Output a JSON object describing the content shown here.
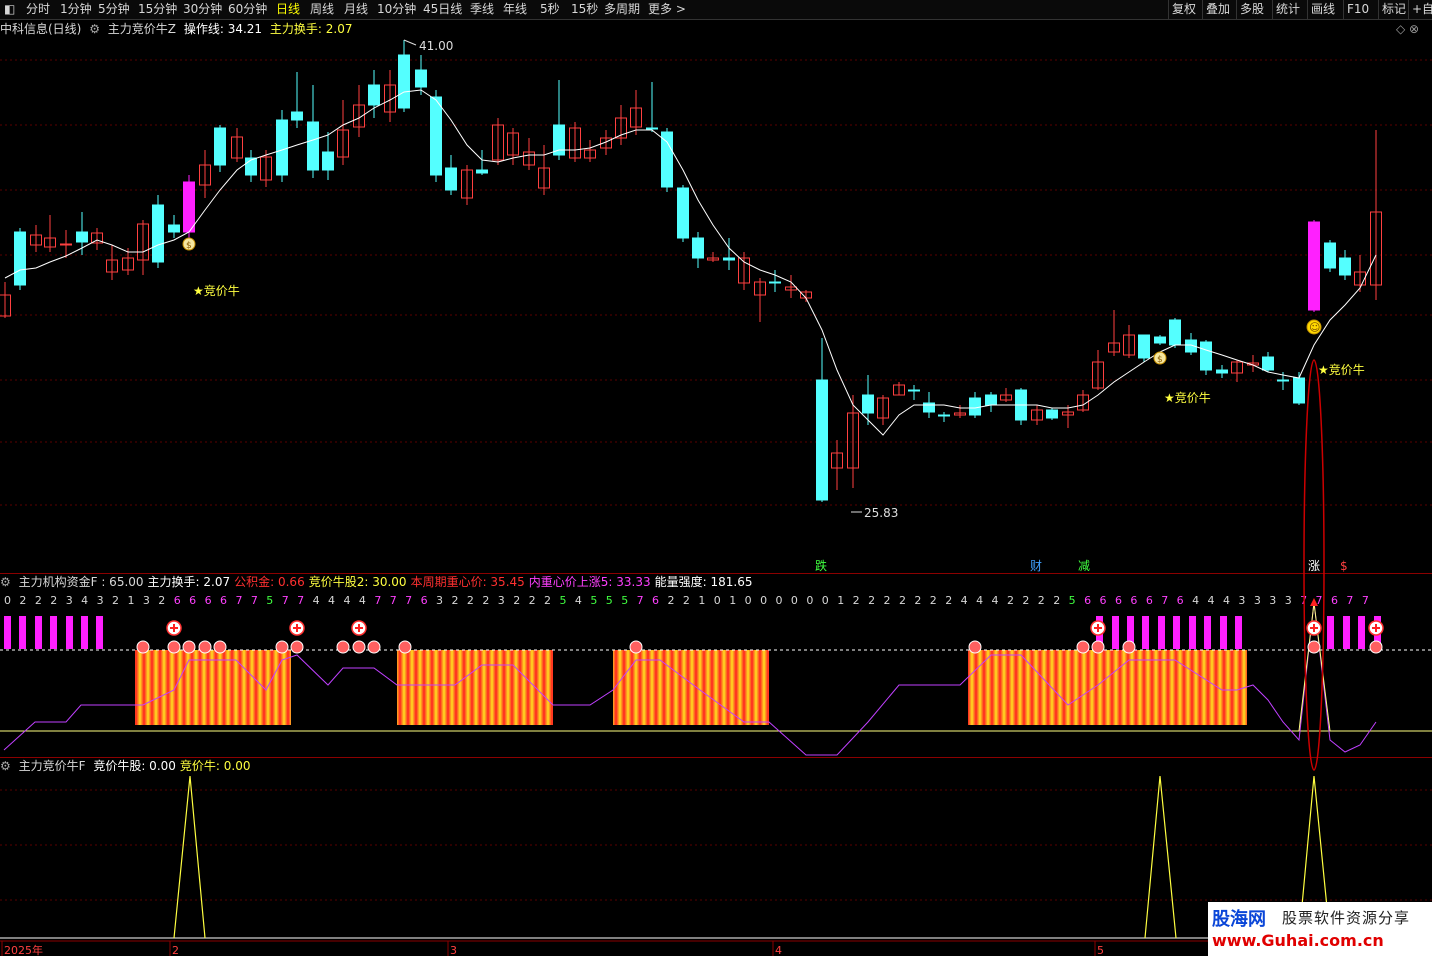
{
  "toolbar": {
    "left_icon": "window-icon",
    "periods": [
      "分时",
      "1分钟",
      "5分钟",
      "15分钟",
      "30分钟",
      "60分钟",
      "日线",
      "周线",
      "月线",
      "10分钟",
      "45日线",
      "季线",
      "年线",
      "5秒",
      "15秒",
      "多周期",
      "更多 >"
    ],
    "active_index": 6,
    "right_tools": [
      "复权",
      "叠加",
      "多股",
      "统计",
      "画线",
      "F10",
      "标记",
      "+自"
    ]
  },
  "main_header": {
    "stock": "中科信息(日线)",
    "indicator": "主力竞价牛Z",
    "op_line_label": "操作线: 34.21",
    "turnover_label": "主力换手: 2.07"
  },
  "price_labels": {
    "high": "41.00",
    "low": "25.83"
  },
  "signals": {
    "jingjianiu": "★竞价牛",
    "die": "跌",
    "cai": "财",
    "jian": "减",
    "zhang": "涨",
    "dollar": "$"
  },
  "panel2_header": {
    "name": "主力机构资金F",
    "items": [
      {
        "text": ": 65.00",
        "color": "#d8d8d8"
      },
      {
        "text": "主力换手: 2.07",
        "color": "#ffffff"
      },
      {
        "text": "公积金: 0.66",
        "color": "#ff3030"
      },
      {
        "text": "竞价牛股2: 30.00",
        "color": "#ffff40"
      },
      {
        "text": "本周期重心价: 35.45",
        "color": "#ff3030"
      },
      {
        "text": "内重心价上涨5: 33.33",
        "color": "#ff40ff"
      },
      {
        "text": "能量强度: 181.65",
        "color": "#ffffff"
      }
    ]
  },
  "digit_row": "0 2 2 2 3 4 3 2 1 3 2 6 6 6 6 7 7 5 7 7 4 4 4 4 7 7 7 6 3 2 2 2 3 2 2 2 5 4 5 5 5 7 6 2 2 1 0 1 0 0 0 0 0 0 1 2 2 2 2 2 2 2 4 4 4 2 2 2 2 5 6 6 6 6 6 7 6 4 4 4 3 3 3 3 7 7 6 7 7",
  "panel3_header": {
    "name": "主力竞价牛F",
    "items": [
      {
        "text": "竞价牛股: 0.00",
        "color": "#ffffff"
      },
      {
        "text": "竞价牛: 0.00",
        "color": "#ffff40"
      }
    ]
  },
  "time_axis": [
    "2025年",
    "2",
    "3",
    "4",
    "5"
  ],
  "watermark": {
    "brand": "股海网",
    "slogan": "股票软件资源分享",
    "url": "www.Guhai.com.cn"
  },
  "colors": {
    "up": "#ff4040",
    "down": "#54ffff",
    "magenta": "#ff20ff",
    "yellow": "#ffff40",
    "ma": "#ffffff"
  }
}
